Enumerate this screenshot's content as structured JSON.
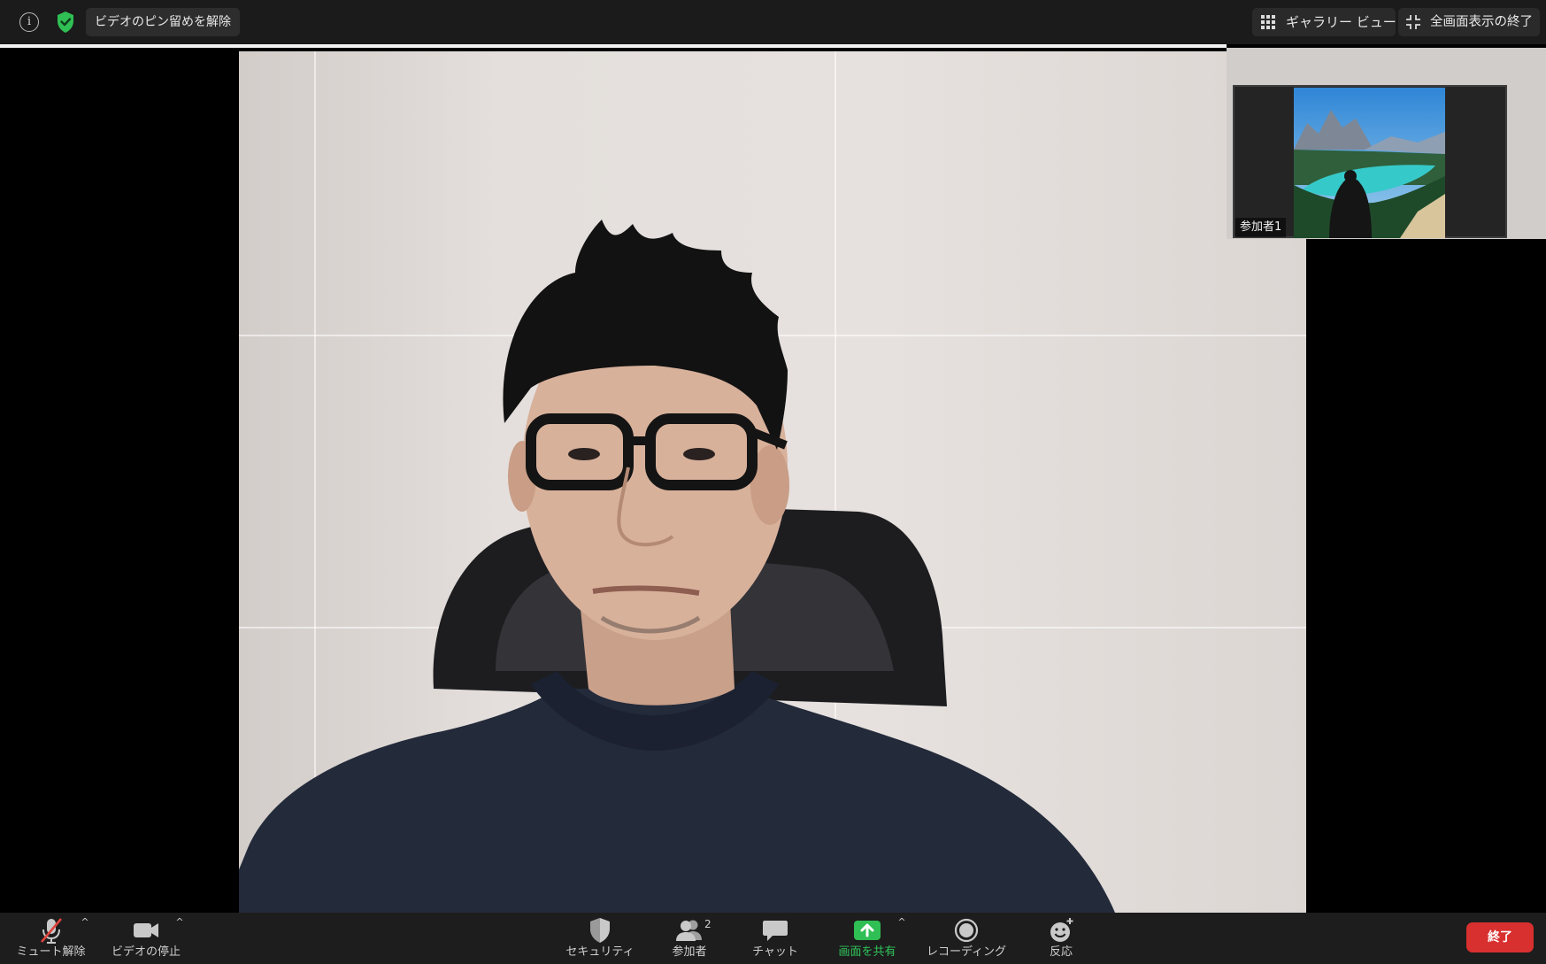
{
  "top_bar": {
    "unpin_label": "ビデオのピン留めを解除",
    "gallery_label": "ギャラリー ビュー",
    "exit_fullscreen_label": "全画面表示の終了",
    "info_glyph": "i",
    "icons": [
      "info-icon",
      "shield-check-icon",
      "grid-icon",
      "shrink-icon"
    ],
    "shield_color": "#2fbf54"
  },
  "thumbnail": {
    "participant_name": "参加者1"
  },
  "toolbar": {
    "unmute_label": "ミュート解除",
    "stop_video_label": "ビデオの停止",
    "security_label": "セキュリティ",
    "participants_label": "参加者",
    "participants_count": "2",
    "chat_label": "チャット",
    "share_screen_label": "画面を共有",
    "recording_label": "レコーディング",
    "reactions_label": "反応",
    "end_label": "終了",
    "caret_glyph": "^",
    "share_color": "#2fbf54",
    "end_color": "#d8302f"
  }
}
